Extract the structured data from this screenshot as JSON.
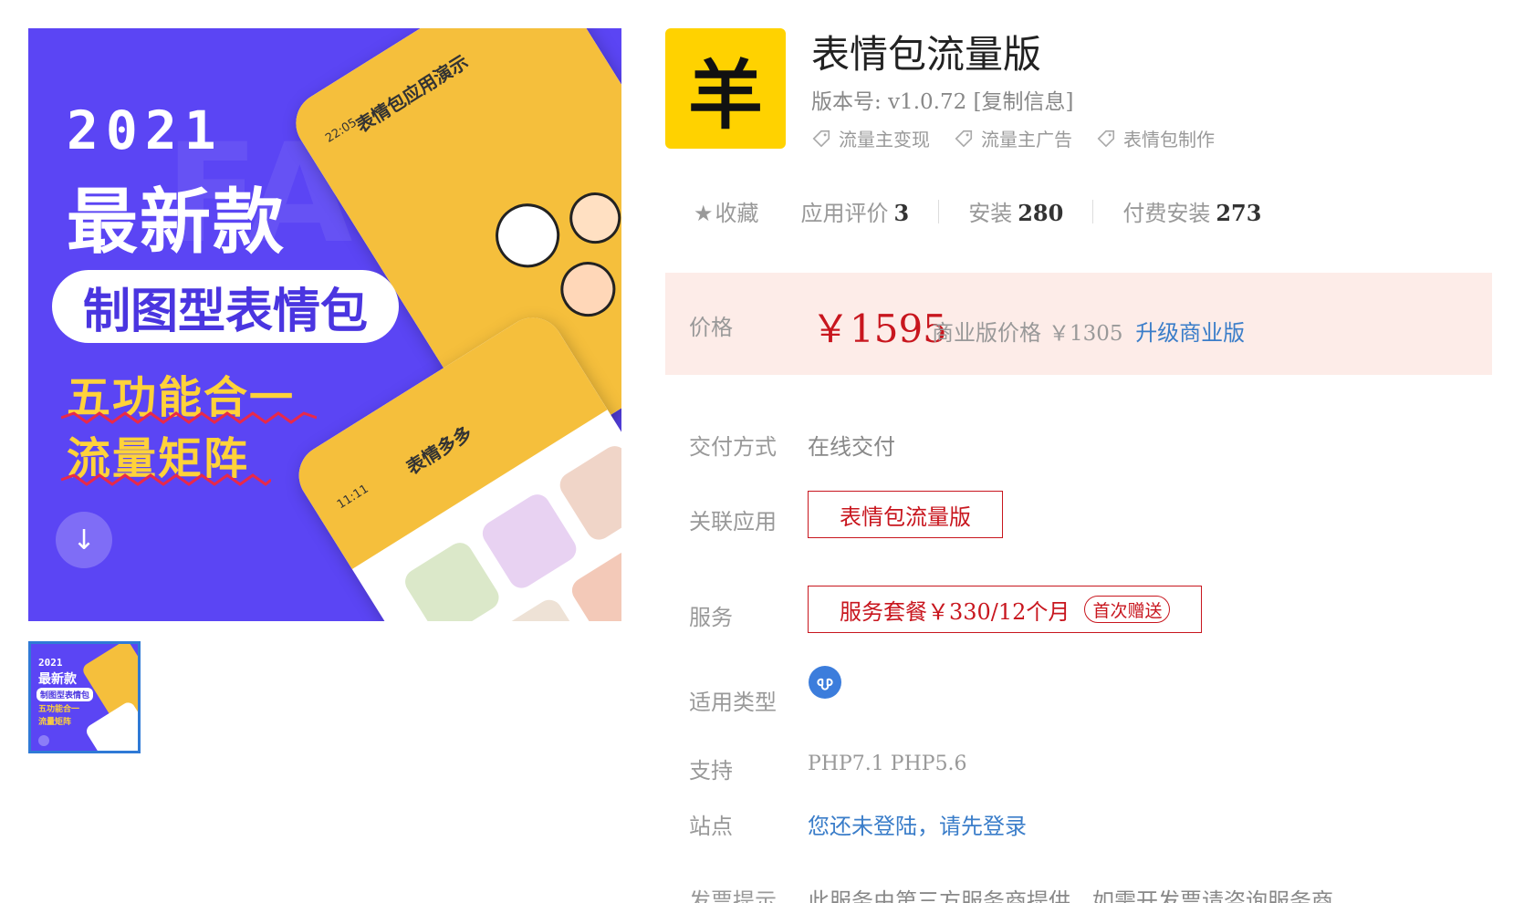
{
  "gallery": {
    "hero": {
      "year": "2021",
      "line1": "最新款",
      "pill": "制图型表情包",
      "line3": "五功能合一",
      "line4": "流量矩阵",
      "ghost": "FACI",
      "phone1_title": "表情包应用演示",
      "phone1_time": "22:05",
      "phone2_title": "表情多多",
      "phone2_time": "11:11",
      "down_arrow": "↓"
    },
    "thumb": {
      "year": "2021",
      "line1": "最新款",
      "pill": "制图型表情包",
      "line3": "五功能合一",
      "line4": "流量矩阵"
    }
  },
  "product": {
    "logo_glyph": "羊",
    "title": "表情包流量版",
    "version_label": "版本号:",
    "version": "v1.0.72",
    "copy_info": "[复制信息]",
    "tags": [
      "流量主变现",
      "流量主广告",
      "表情包制作"
    ]
  },
  "stats": {
    "favorite": "收藏",
    "rating_label": "应用评价",
    "rating_value": "3",
    "install_label": "安装",
    "install_value": "280",
    "paid_label": "付费安装",
    "paid_value": "273"
  },
  "price": {
    "label": "价格",
    "value": "￥1595",
    "business_label": "商业版价格",
    "business_value": "￥1305",
    "upgrade": "升级商业版"
  },
  "details": {
    "delivery_label": "交付方式",
    "delivery_value": "在线交付",
    "related_label": "关联应用",
    "related_value": "表情包流量版",
    "service_label": "服务",
    "service_name": "服务套餐",
    "service_price": "￥330/12个月",
    "service_gift": "首次赠送",
    "type_label": "适用类型",
    "support_label": "支持",
    "support_value": "PHP7.1 PHP5.6",
    "site_label": "站点",
    "site_value": "您还未登陆，请先登录",
    "invoice_label": "发票提示",
    "invoice_value": "此服务由第三方服务商提供，如需开发票请咨询服务商"
  },
  "colors": {
    "accent_red": "#c8161e",
    "link_blue": "#3a7dc9",
    "price_bg": "#fdece8",
    "hero_bg": "#5b45f4",
    "logo_bg": "#ffd200"
  }
}
